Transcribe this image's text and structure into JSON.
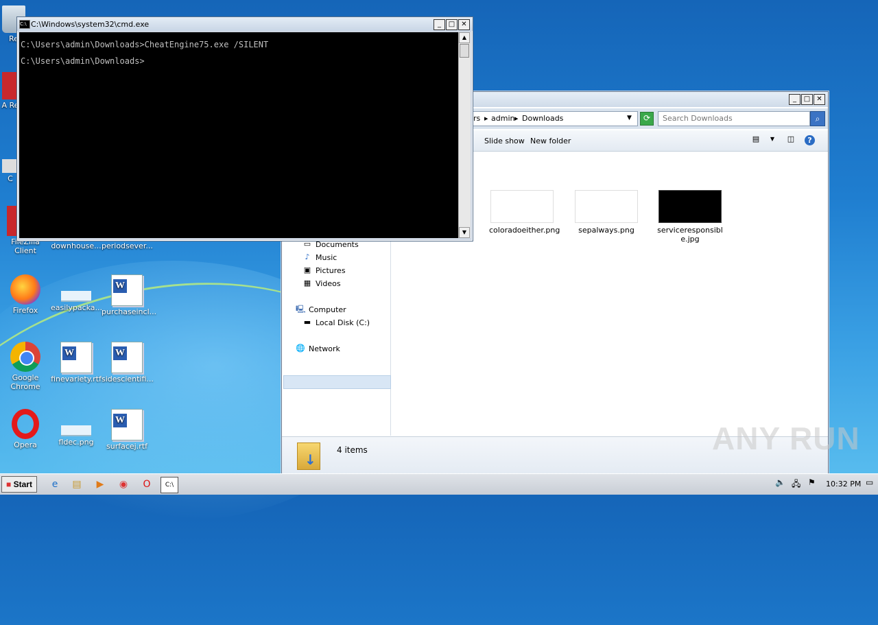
{
  "desktop": {
    "icons": [
      {
        "label": "Re",
        "kind": "recycle-bin"
      },
      {
        "label": "A Re",
        "kind": "app"
      },
      {
        "label": "C",
        "kind": "app"
      },
      {
        "label": "FileZilla Client",
        "kind": "app"
      },
      {
        "label": "downhouse...",
        "kind": "doc"
      },
      {
        "label": "periodsever...",
        "kind": "doc"
      },
      {
        "label": "Firefox",
        "kind": "firefox"
      },
      {
        "label": "easilypacka...",
        "kind": "png"
      },
      {
        "label": "purchaseincl...",
        "kind": "doc"
      },
      {
        "label": "Google Chrome",
        "kind": "chrome"
      },
      {
        "label": "finevariety.rtf",
        "kind": "doc"
      },
      {
        "label": "sidescientifi...",
        "kind": "doc"
      },
      {
        "label": "Opera",
        "kind": "opera"
      },
      {
        "label": "fldec.png",
        "kind": "png"
      },
      {
        "label": "surfacej.rtf",
        "kind": "doc"
      }
    ]
  },
  "cmd": {
    "title": "C:\\Windows\\system32\\cmd.exe",
    "icon_text": "C:\\",
    "lines": [
      "C:\\Users\\admin\\Downloads>CheatEngine75.exe /SILENT",
      "C:\\Users\\admin\\Downloads>"
    ]
  },
  "explorer": {
    "breadcrumb": [
      "rs",
      "admin",
      "Downloads"
    ],
    "search_placeholder": "Search Downloads",
    "commands": [
      "Slide show",
      "New folder"
    ],
    "nav": {
      "documents": "Documents",
      "music": "Music",
      "pictures": "Pictures",
      "videos": "Videos",
      "computer": "Computer",
      "local_disk": "Local Disk (C:)",
      "network": "Network"
    },
    "files": [
      {
        "name": "coloradoeither.png",
        "thumb": "white"
      },
      {
        "name": "sepalways.png",
        "thumb": "white"
      },
      {
        "name": "serviceresponsible.jpg",
        "thumb": "black"
      }
    ],
    "status": "4 items"
  },
  "taskbar": {
    "start_label": "Start",
    "clock": "10:32 PM"
  },
  "watermark": "ANY RUN",
  "colors": {
    "console_bg": "#000000",
    "console_fg": "#c0c0c0",
    "desktop_top": "#1565b8",
    "selection": "#d8e6f5"
  }
}
